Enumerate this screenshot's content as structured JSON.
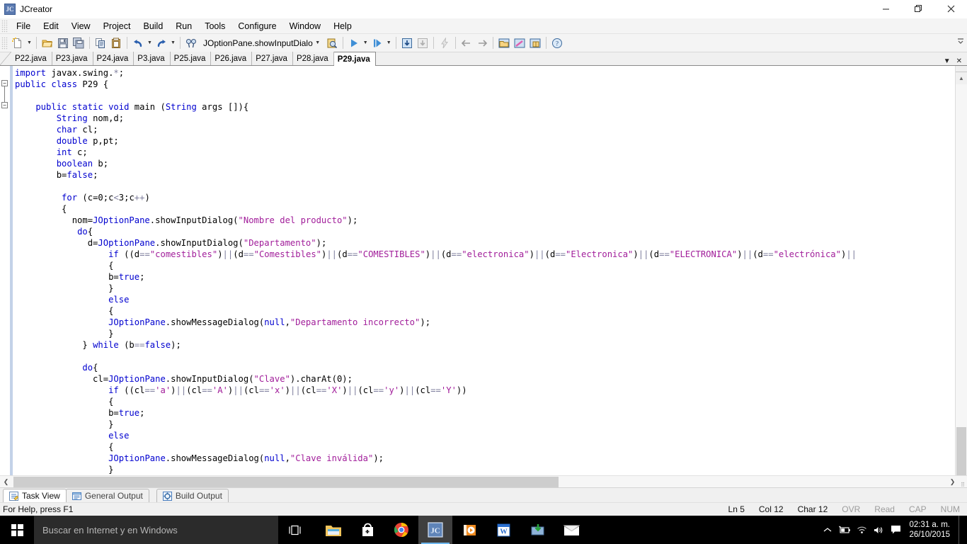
{
  "window": {
    "title": "JCreator",
    "app_icon": "jcreator-logo-icon",
    "minimize_label": "Minimize",
    "maximize_label": "Maximize",
    "close_label": "Close"
  },
  "menubar": {
    "items": [
      {
        "label": "File"
      },
      {
        "label": "Edit"
      },
      {
        "label": "View"
      },
      {
        "label": "Project"
      },
      {
        "label": "Build"
      },
      {
        "label": "Run"
      },
      {
        "label": "Tools"
      },
      {
        "label": "Configure"
      },
      {
        "label": "Window"
      },
      {
        "label": "Help"
      }
    ]
  },
  "toolbar": {
    "combo_value": "JOptionPane.showInputDialo",
    "overflow_label": "»",
    "buttons": [
      {
        "name": "new-file-icon",
        "title": "New"
      },
      {
        "name": "open-file-icon",
        "title": "Open"
      },
      {
        "name": "save-icon",
        "title": "Save"
      },
      {
        "name": "save-all-icon",
        "title": "Save All"
      },
      {
        "name": "copy-icon",
        "title": "Copy"
      },
      {
        "name": "paste-icon",
        "title": "Paste"
      },
      {
        "name": "undo-icon",
        "title": "Undo"
      },
      {
        "name": "redo-icon",
        "title": "Redo"
      },
      {
        "name": "find-icon",
        "title": "Find"
      },
      {
        "name": "run-icon",
        "title": "Run"
      },
      {
        "name": "run-step-icon",
        "title": "Step"
      },
      {
        "name": "compile-icon",
        "title": "Compile"
      },
      {
        "name": "compile-all-icon",
        "title": "Compile All"
      },
      {
        "name": "lightning-icon",
        "title": "Execute"
      },
      {
        "name": "back-arrow-icon",
        "title": "Back"
      },
      {
        "name": "forward-arrow-icon",
        "title": "Forward"
      },
      {
        "name": "project-view-icon",
        "title": "Project View"
      },
      {
        "name": "class-view-icon",
        "title": "Class View"
      },
      {
        "name": "package-view-icon",
        "title": "Package View"
      },
      {
        "name": "help-icon",
        "title": "Help"
      }
    ]
  },
  "editor_tabs": {
    "items": [
      {
        "label": "P22.java",
        "active": false
      },
      {
        "label": "P23.java",
        "active": false
      },
      {
        "label": "P24.java",
        "active": false
      },
      {
        "label": "P3.java",
        "active": false
      },
      {
        "label": "P25.java",
        "active": false
      },
      {
        "label": "P26.java",
        "active": false
      },
      {
        "label": "P27.java",
        "active": false
      },
      {
        "label": "P28.java",
        "active": false
      },
      {
        "label": "P29.java",
        "active": true
      }
    ],
    "dropdown_icon": "chevron-down-icon",
    "close_icon": "close-icon"
  },
  "editor": {
    "language": "java",
    "code_lines": [
      [
        {
          "t": "import",
          "c": "kw"
        },
        {
          "t": " javax.swing.",
          "c": ""
        },
        {
          "t": "*",
          "c": "op"
        },
        {
          "t": ";",
          "c": ""
        }
      ],
      [
        {
          "t": "public class",
          "c": "kw"
        },
        {
          "t": " P29 {",
          "c": ""
        }
      ],
      [],
      [
        {
          "t": "    public static void",
          "c": "kw"
        },
        {
          "t": " main (",
          "c": ""
        },
        {
          "t": "String",
          "c": "kw"
        },
        {
          "t": " args []){",
          "c": ""
        }
      ],
      [
        {
          "t": "        String",
          "c": "kw"
        },
        {
          "t": " nom,d;",
          "c": ""
        }
      ],
      [
        {
          "t": "        char",
          "c": "kw"
        },
        {
          "t": " cl;",
          "c": ""
        }
      ],
      [
        {
          "t": "        double",
          "c": "kw"
        },
        {
          "t": " p,pt;",
          "c": ""
        }
      ],
      [
        {
          "t": "        int",
          "c": "kw"
        },
        {
          "t": " c;",
          "c": ""
        }
      ],
      [
        {
          "t": "        boolean",
          "c": "kw"
        },
        {
          "t": " b;",
          "c": ""
        }
      ],
      [
        {
          "t": "        b=",
          "c": ""
        },
        {
          "t": "false",
          "c": "kw"
        },
        {
          "t": ";",
          "c": ""
        }
      ],
      [],
      [
        {
          "t": "         ",
          "c": ""
        },
        {
          "t": "for",
          "c": "kw"
        },
        {
          "t": " (c=0;c",
          "c": ""
        },
        {
          "t": "<",
          "c": "op"
        },
        {
          "t": "3;c",
          "c": ""
        },
        {
          "t": "++",
          "c": "op"
        },
        {
          "t": ")",
          "c": ""
        }
      ],
      [
        {
          "t": "         {",
          "c": ""
        }
      ],
      [
        {
          "t": "           nom=",
          "c": ""
        },
        {
          "t": "JOptionPane",
          "c": "kw"
        },
        {
          "t": ".showInputDialog(",
          "c": ""
        },
        {
          "t": "\"Nombre del producto\"",
          "c": "str"
        },
        {
          "t": ");",
          "c": ""
        }
      ],
      [
        {
          "t": "            ",
          "c": ""
        },
        {
          "t": "do",
          "c": "kw"
        },
        {
          "t": "{",
          "c": ""
        }
      ],
      [
        {
          "t": "              d=",
          "c": ""
        },
        {
          "t": "JOptionPane",
          "c": "kw"
        },
        {
          "t": ".showInputDialog(",
          "c": ""
        },
        {
          "t": "\"Departamento\"",
          "c": "str"
        },
        {
          "t": ");",
          "c": ""
        }
      ],
      [
        {
          "t": "                  ",
          "c": ""
        },
        {
          "t": "if",
          "c": "kw"
        },
        {
          "t": " ((d",
          "c": ""
        },
        {
          "t": "==",
          "c": "op"
        },
        {
          "t": "\"comestibles\"",
          "c": "str"
        },
        {
          "t": ")",
          "c": ""
        },
        {
          "t": "||",
          "c": "op"
        },
        {
          "t": "(d",
          "c": ""
        },
        {
          "t": "==",
          "c": "op"
        },
        {
          "t": "\"Comestibles\"",
          "c": "str"
        },
        {
          "t": ")",
          "c": ""
        },
        {
          "t": "||",
          "c": "op"
        },
        {
          "t": "(d",
          "c": ""
        },
        {
          "t": "==",
          "c": "op"
        },
        {
          "t": "\"COMESTIBLES\"",
          "c": "str"
        },
        {
          "t": ")",
          "c": ""
        },
        {
          "t": "||",
          "c": "op"
        },
        {
          "t": "(d",
          "c": ""
        },
        {
          "t": "==",
          "c": "op"
        },
        {
          "t": "\"electronica\"",
          "c": "str"
        },
        {
          "t": ")",
          "c": ""
        },
        {
          "t": "||",
          "c": "op"
        },
        {
          "t": "(d",
          "c": ""
        },
        {
          "t": "==",
          "c": "op"
        },
        {
          "t": "\"Electronica\"",
          "c": "str"
        },
        {
          "t": ")",
          "c": ""
        },
        {
          "t": "||",
          "c": "op"
        },
        {
          "t": "(d",
          "c": ""
        },
        {
          "t": "==",
          "c": "op"
        },
        {
          "t": "\"ELECTRONICA\"",
          "c": "str"
        },
        {
          "t": ")",
          "c": ""
        },
        {
          "t": "||",
          "c": "op"
        },
        {
          "t": "(d",
          "c": ""
        },
        {
          "t": "==",
          "c": "op"
        },
        {
          "t": "\"electrónica\"",
          "c": "str"
        },
        {
          "t": ")",
          "c": ""
        },
        {
          "t": "||",
          "c": "op"
        }
      ],
      [
        {
          "t": "                  {",
          "c": ""
        }
      ],
      [
        {
          "t": "                  b=",
          "c": ""
        },
        {
          "t": "true",
          "c": "kw"
        },
        {
          "t": ";",
          "c": ""
        }
      ],
      [
        {
          "t": "                  }",
          "c": ""
        }
      ],
      [
        {
          "t": "                  ",
          "c": ""
        },
        {
          "t": "else",
          "c": "kw"
        }
      ],
      [
        {
          "t": "                  {",
          "c": ""
        }
      ],
      [
        {
          "t": "                  ",
          "c": ""
        },
        {
          "t": "JOptionPane",
          "c": "kw"
        },
        {
          "t": ".showMessageDialog(",
          "c": ""
        },
        {
          "t": "null",
          "c": "kw"
        },
        {
          "t": ",",
          "c": ""
        },
        {
          "t": "\"Departamento incorrecto\"",
          "c": "str"
        },
        {
          "t": ");",
          "c": ""
        }
      ],
      [
        {
          "t": "                  }",
          "c": ""
        }
      ],
      [
        {
          "t": "             } ",
          "c": ""
        },
        {
          "t": "while",
          "c": "kw"
        },
        {
          "t": " (b",
          "c": ""
        },
        {
          "t": "==",
          "c": "op"
        },
        {
          "t": "false",
          "c": "kw"
        },
        {
          "t": ");",
          "c": ""
        }
      ],
      [],
      [
        {
          "t": "             ",
          "c": ""
        },
        {
          "t": "do",
          "c": "kw"
        },
        {
          "t": "{",
          "c": ""
        }
      ],
      [
        {
          "t": "               cl=",
          "c": ""
        },
        {
          "t": "JOptionPane",
          "c": "kw"
        },
        {
          "t": ".showInputDialog(",
          "c": ""
        },
        {
          "t": "\"Clave\"",
          "c": "str"
        },
        {
          "t": ").charAt(0);",
          "c": ""
        }
      ],
      [
        {
          "t": "                  ",
          "c": ""
        },
        {
          "t": "if",
          "c": "kw"
        },
        {
          "t": " ((cl",
          "c": ""
        },
        {
          "t": "==",
          "c": "op"
        },
        {
          "t": "'a'",
          "c": "str"
        },
        {
          "t": ")",
          "c": ""
        },
        {
          "t": "||",
          "c": "op"
        },
        {
          "t": "(cl",
          "c": ""
        },
        {
          "t": "==",
          "c": "op"
        },
        {
          "t": "'A'",
          "c": "str"
        },
        {
          "t": ")",
          "c": ""
        },
        {
          "t": "||",
          "c": "op"
        },
        {
          "t": "(cl",
          "c": ""
        },
        {
          "t": "==",
          "c": "op"
        },
        {
          "t": "'x'",
          "c": "str"
        },
        {
          "t": ")",
          "c": ""
        },
        {
          "t": "||",
          "c": "op"
        },
        {
          "t": "(cl",
          "c": ""
        },
        {
          "t": "==",
          "c": "op"
        },
        {
          "t": "'X'",
          "c": "str"
        },
        {
          "t": ")",
          "c": ""
        },
        {
          "t": "||",
          "c": "op"
        },
        {
          "t": "(cl",
          "c": ""
        },
        {
          "t": "==",
          "c": "op"
        },
        {
          "t": "'y'",
          "c": "str"
        },
        {
          "t": ")",
          "c": ""
        },
        {
          "t": "||",
          "c": "op"
        },
        {
          "t": "(cl",
          "c": ""
        },
        {
          "t": "==",
          "c": "op"
        },
        {
          "t": "'Y'",
          "c": "str"
        },
        {
          "t": "))",
          "c": ""
        }
      ],
      [
        {
          "t": "                  {",
          "c": ""
        }
      ],
      [
        {
          "t": "                  b=",
          "c": ""
        },
        {
          "t": "true",
          "c": "kw"
        },
        {
          "t": ";",
          "c": ""
        }
      ],
      [
        {
          "t": "                  }",
          "c": ""
        }
      ],
      [
        {
          "t": "                  ",
          "c": ""
        },
        {
          "t": "else",
          "c": "kw"
        }
      ],
      [
        {
          "t": "                  {",
          "c": ""
        }
      ],
      [
        {
          "t": "                  ",
          "c": ""
        },
        {
          "t": "JOptionPane",
          "c": "kw"
        },
        {
          "t": ".showMessageDialog(",
          "c": ""
        },
        {
          "t": "null",
          "c": "kw"
        },
        {
          "t": ",",
          "c": ""
        },
        {
          "t": "\"Clave inválida\"",
          "c": "str"
        },
        {
          "t": ");",
          "c": ""
        }
      ],
      [
        {
          "t": "                  }",
          "c": ""
        }
      ]
    ]
  },
  "panel_tabs": {
    "items": [
      {
        "label": "Task View",
        "icon": "task-view-icon",
        "active": true
      },
      {
        "label": "General Output",
        "icon": "general-output-icon",
        "active": false
      },
      {
        "label": "Build Output",
        "icon": "build-output-icon",
        "active": false
      }
    ]
  },
  "statusbar": {
    "help_text": "For Help, press F1",
    "line": "Ln 5",
    "column": "Col 12",
    "character": "Char 12",
    "overwrite": "OVR",
    "readonly": "Read",
    "capslock": "CAP",
    "numlock": "NUM"
  },
  "taskbar": {
    "start_icon": "windows-logo-icon",
    "search_placeholder": "Buscar en Internet y en Windows",
    "taskview_icon": "task-view-icon",
    "apps": [
      {
        "name": "file-explorer-icon",
        "label": "Explorador de archivos",
        "active": false
      },
      {
        "name": "microsoft-store-icon",
        "label": "Tienda",
        "active": false
      },
      {
        "name": "google-chrome-icon",
        "label": "Google Chrome",
        "active": false
      },
      {
        "name": "jcreator-icon",
        "label": "JCreator",
        "active": true
      },
      {
        "name": "media-player-icon",
        "label": "Reproductor",
        "active": false
      },
      {
        "name": "microsoft-word-icon",
        "label": "Word",
        "active": false
      },
      {
        "name": "download-manager-icon",
        "label": "Descargas",
        "active": false
      },
      {
        "name": "mail-icon",
        "label": "Correo",
        "active": false
      }
    ],
    "tray": [
      {
        "name": "show-hidden-icons-icon"
      },
      {
        "name": "battery-icon"
      },
      {
        "name": "wifi-icon"
      },
      {
        "name": "volume-icon"
      },
      {
        "name": "action-center-icon"
      }
    ],
    "clock_time": "02:31 a. m.",
    "clock_date": "26/10/2015"
  },
  "colors": {
    "keyword": "#0000cf",
    "string": "#a11d9a",
    "operator": "#7f7f9e",
    "tab_active_bg": "#ffffff",
    "chrome_bg": "#f0f0f0",
    "taskbar_bg": "#000000",
    "accent": "#6eb8ef"
  }
}
